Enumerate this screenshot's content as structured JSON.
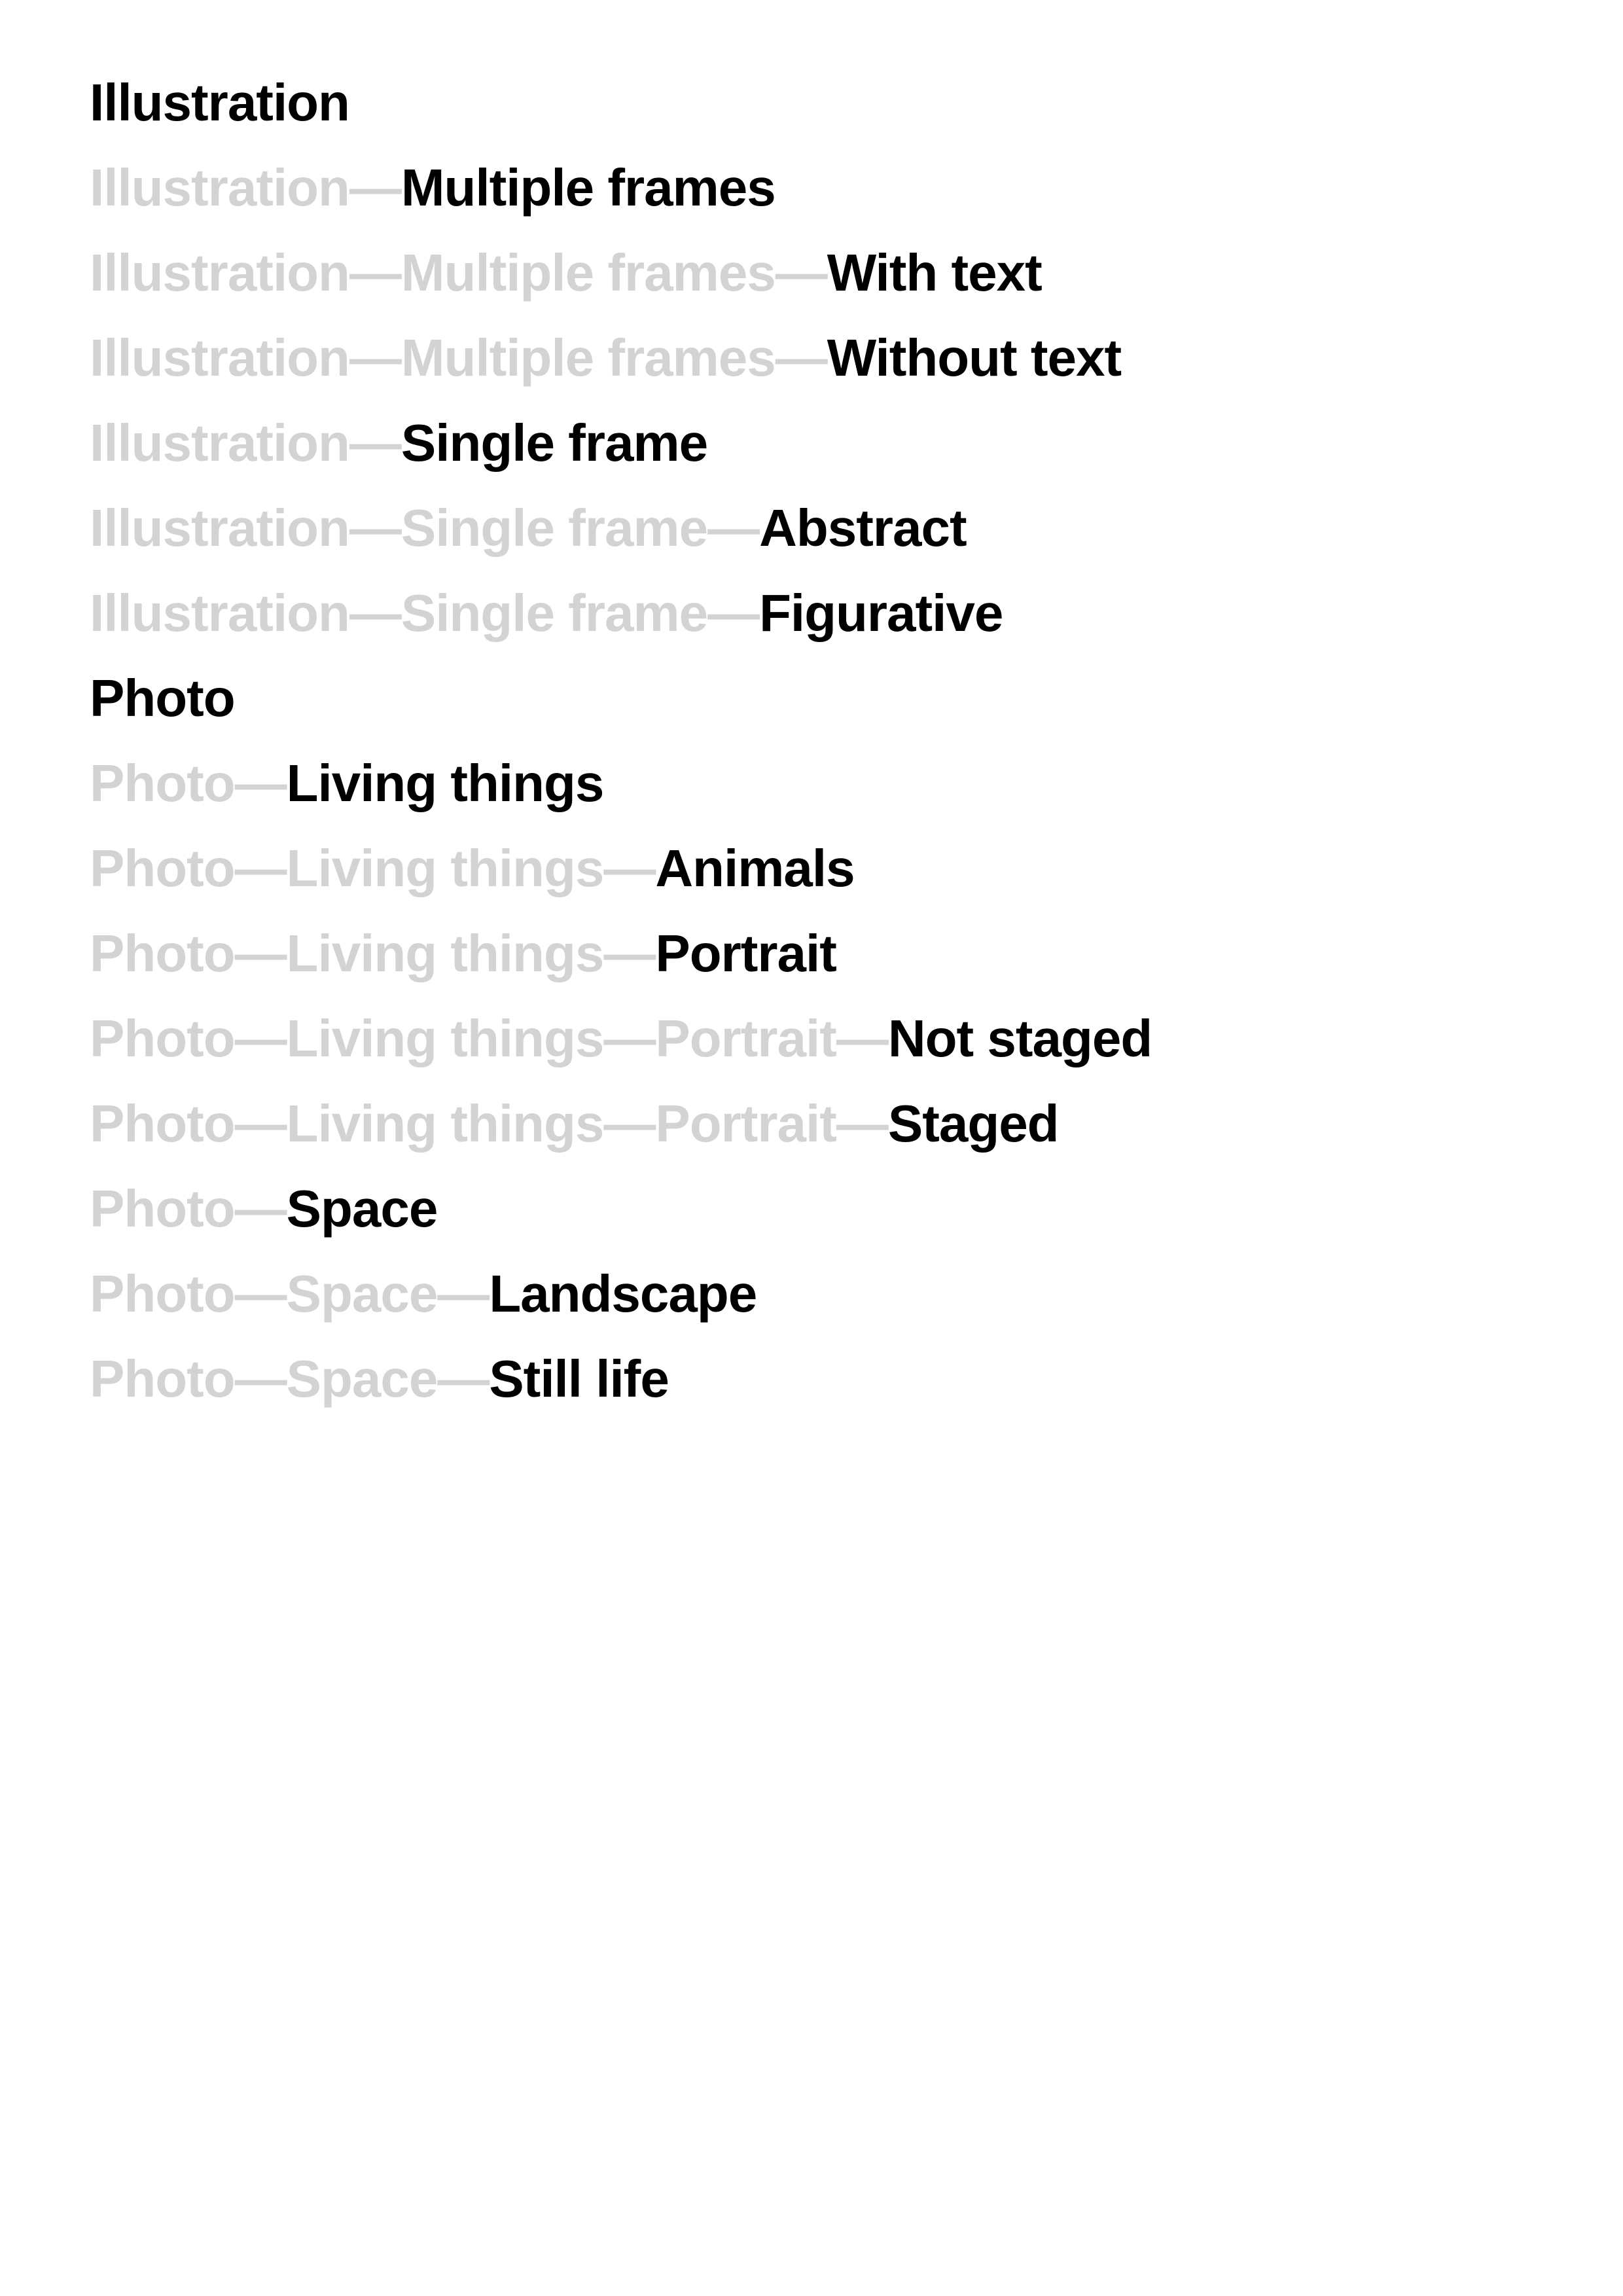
{
  "colors": {
    "ancestor_text": "#d3d3d3",
    "leaf_text": "#000000",
    "background": "#ffffff"
  },
  "separator": "—",
  "rows": [
    {
      "path": "",
      "leaf": "Illustration"
    },
    {
      "path": "Illustration—",
      "leaf": "Multiple frames"
    },
    {
      "path": "Illustration—Multiple frames—",
      "leaf": "With text"
    },
    {
      "path": "Illustration—Multiple frames—",
      "leaf": "Without text"
    },
    {
      "path": "Illustration—",
      "leaf": "Single frame"
    },
    {
      "path": "Illustration—Single frame—",
      "leaf": "Abstract"
    },
    {
      "path": "Illustration—Single frame—",
      "leaf": "Figurative"
    },
    {
      "path": "",
      "leaf": "Photo"
    },
    {
      "path": "Photo—",
      "leaf": "Living things"
    },
    {
      "path": "Photo—Living things—",
      "leaf": "Animals"
    },
    {
      "path": "Photo—Living things—",
      "leaf": "Portrait"
    },
    {
      "path": "Photo—Living things—Portrait—",
      "leaf": "Not staged"
    },
    {
      "path": "Photo—Living things—Portrait—",
      "leaf": "Staged"
    },
    {
      "path": "Photo—",
      "leaf": "Space"
    },
    {
      "path": "Photo—Space—",
      "leaf": "Landscape"
    },
    {
      "path": "Photo—Space—",
      "leaf": "Still life"
    }
  ]
}
